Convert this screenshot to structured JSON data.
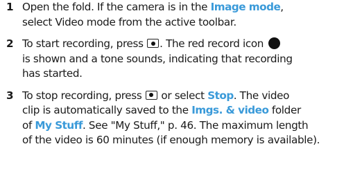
{
  "steps": [
    {
      "num": "1",
      "t1": "Open the fold. If the camera is in the ",
      "h1": "Image mode",
      "t2": ",",
      "t3": "select Video mode from the active toolbar."
    },
    {
      "num": "2",
      "t1": "To start recording, press ",
      "t2": ". The red record icon ",
      "t3": "is shown and a tone sounds, indicating that recording",
      "t4": "has started."
    },
    {
      "num": "3",
      "t1": "To stop recording, press ",
      "t2": " or select ",
      "h1": "Stop",
      "t3": ". The video",
      "t4": "clip is automatically saved to the ",
      "h2": "Imgs. & video",
      "t5": " folder",
      "t6": "of ",
      "h3": "My Stuff",
      "t7": ". See \"My Stuff,\" p. 46. The maximum length",
      "t8": "of the video is 60 minutes (if enough memory is available)."
    }
  ],
  "icons": {
    "camera_key": "camera-key-icon",
    "record": "record-icon"
  },
  "colors": {
    "highlight": "#3a9ad9",
    "text": "#1a1a1a"
  }
}
